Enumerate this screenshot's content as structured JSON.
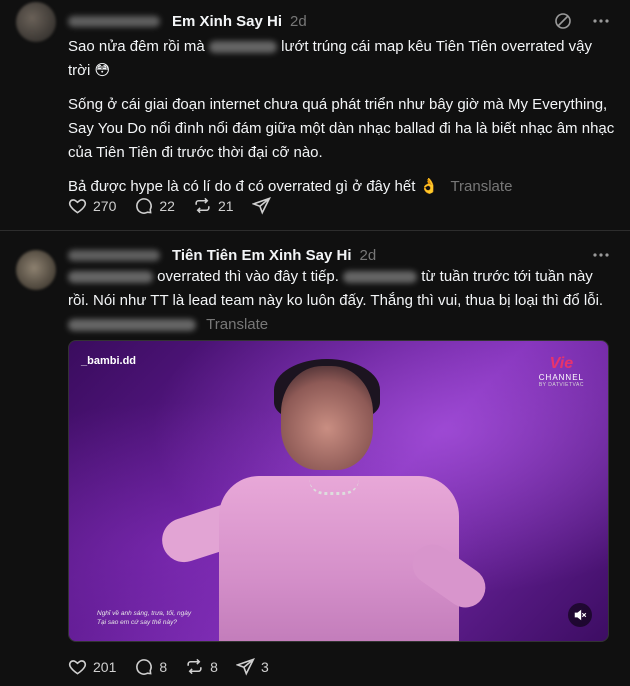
{
  "post1": {
    "username": "Em Xinh Say Hi",
    "time": "2d",
    "paragraph1_start": "Sao nửa đêm rồi mà",
    "paragraph1_end": "lướt trúng cái map kêu Tiên Tiên overrated vậy",
    "paragraph1_line2": "trời 😳",
    "paragraph2": "Sống ở cái giai đoạn internet chưa quá phát triển như bây giờ mà My Everything, Say You Do nổi đình nổi đám giữa một dàn nhạc ballad đi ha là biết nhạc âm nhạc của Tiên Tiên đi trước thời đại cỡ nào.",
    "paragraph3": "Bả được hype là có lí do đ có overrated gì ở đây hết 👌",
    "translate_label": "Translate",
    "likes": "270",
    "comments": "22",
    "reposts": "21"
  },
  "post2": {
    "username": "Tiên Tiên Em Xinh Say Hi",
    "time": "2d",
    "line1_mid": "overrated thì vào đây t tiếp.",
    "line1_end": "từ tuần trước tới tuần này",
    "line2": "rồi. Nói như TT là lead team này ko luôn đấy. Thắng thì vui, thua bị loại thì đổ lỗi.",
    "translate_label": "Translate",
    "video": {
      "watermark": "_bambi.dd",
      "logo_brand": "Vie",
      "logo_channel": "CHANNEL",
      "logo_sub": "BY DATVIETVAC",
      "caption_line1": "Nghĩ về anh sáng, trưa, tối, ngày",
      "caption_line2": "Tại sao em cứ say thế này?"
    },
    "likes": "201",
    "comments": "8",
    "reposts": "8",
    "shares": "3"
  }
}
